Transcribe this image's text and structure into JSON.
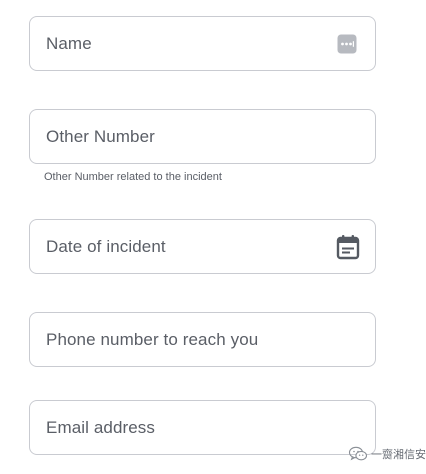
{
  "form": {
    "fields": [
      {
        "placeholder": "Name",
        "icon": "password-manager-dots-icon"
      },
      {
        "placeholder": "Other Number",
        "helper": "Other Number related to the incident"
      },
      {
        "placeholder": "Date of incident",
        "icon": "calendar-icon"
      },
      {
        "placeholder": "Phone number to reach you"
      },
      {
        "placeholder": "Email address"
      }
    ]
  },
  "watermark": {
    "text": "一齌湘信安",
    "icon": "wechat-icon"
  },
  "colors": {
    "border": "#c9cbd1",
    "text": "#5a5e66",
    "icon_gray": "#b7bac0",
    "icon_dark": "#555a62"
  }
}
